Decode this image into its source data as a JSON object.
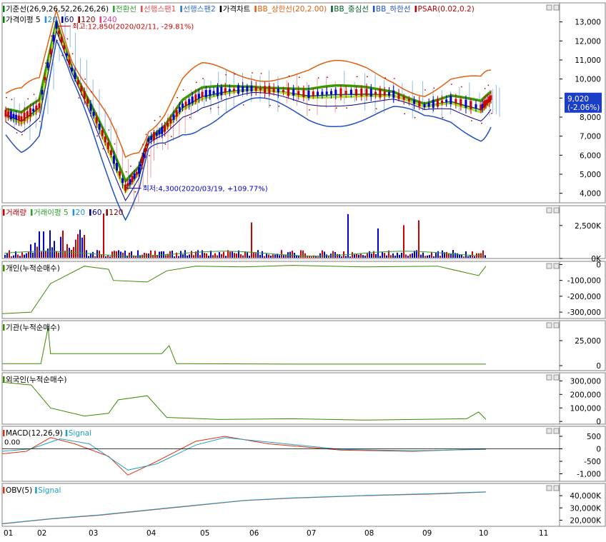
{
  "legend_main": [
    {
      "text": "기준선(26,9,26,52,26,26,26)",
      "color": "#000000",
      "mark": "#008000"
    },
    {
      "text": "전환선",
      "color": "#2ca02c",
      "mark": "#2ca02c"
    },
    {
      "text": "선행스팬1",
      "color": "#e05050",
      "mark": "#e05050"
    },
    {
      "text": "선행스팬2",
      "color": "#3070d0",
      "mark": "#3070d0"
    },
    {
      "text": "가격차트",
      "color": "#000000",
      "mark": "#000000"
    },
    {
      "text": "BB_상한선(20,2.00)",
      "color": "#e06010",
      "mark": "#e06010"
    },
    {
      "text": "BB_중심선",
      "color": "#006020",
      "mark": "#006020"
    },
    {
      "text": "BB_하한선",
      "color": "#2050c0",
      "mark": "#2050c0"
    },
    {
      "text": "PSAR(0.02,0.2)",
      "color": "#c00000",
      "mark": "#c00000"
    }
  ],
  "legend_main2": [
    {
      "text": "가격이평 5",
      "color": "#000000",
      "mark": "#008000"
    },
    {
      "text": "20",
      "color": "#2090e0",
      "mark": "#2090e0"
    },
    {
      "text": "60",
      "color": "#000080",
      "mark": "#000080"
    },
    {
      "text": "120",
      "color": "#800000",
      "mark": "#800000"
    },
    {
      "text": "240",
      "color": "#e040a0",
      "mark": "#e040a0"
    }
  ],
  "annotations": {
    "high": "최고:12,850(2020/02/11, -29.81%)",
    "low": "최저:4,300(2020/03/19, +109.77%)",
    "price_tag_value": "9,020",
    "price_tag_change": "(-2.06%)"
  },
  "legend_volume": [
    {
      "text": "거래량",
      "color": "#cc0000",
      "mark": "#cc0000"
    },
    {
      "text": "거래이평 5",
      "color": "#2ca02c",
      "mark": "#2ca02c"
    },
    {
      "text": "20",
      "color": "#2090e0",
      "mark": "#2090e0"
    },
    {
      "text": "60",
      "color": "#000080",
      "mark": "#000080"
    },
    {
      "text": "120",
      "color": "#800000",
      "mark": "#800000"
    }
  ],
  "panel_titles": {
    "individual": "개인(누적순매수)",
    "institution": "기관(누적순매수)",
    "foreign": "외국인(누적순매수)",
    "macd": "MACD(12,26,9)",
    "macd_signal": "Signal",
    "macd_zero": "0.00",
    "obv": "OBV(5)",
    "obv_signal": "Signal"
  },
  "colors": {
    "up": "#cc0000",
    "down": "#0000cc",
    "grid": "#c8c8c8",
    "line_green": "#3a8a00",
    "macd": "#e03010",
    "signal": "#20a0c0"
  },
  "chart_data": [
    {
      "type": "candlestick",
      "title": "",
      "ylim": [
        3500,
        14000
      ],
      "y_ticks": [
        4000,
        5000,
        6000,
        7000,
        8000,
        9000,
        10000,
        11000,
        12000,
        13000
      ],
      "y_tick_labels": [
        "4,000",
        "5,000",
        "6,000",
        "7,000",
        "8,000",
        "9,000",
        "10,000",
        "11,000",
        "12,000",
        "13,000"
      ],
      "x_months": [
        "01",
        "02",
        "03",
        "04",
        "05",
        "06",
        "07",
        "08",
        "09",
        "10",
        "11"
      ],
      "close_approx": [
        [
          "01",
          8200
        ],
        [
          "01-15",
          7900
        ],
        [
          "02-01",
          8600
        ],
        [
          "02-11",
          12850
        ],
        [
          "02-20",
          10500
        ],
        [
          "03-01",
          8500
        ],
        [
          "03-10",
          6500
        ],
        [
          "03-19",
          4300
        ],
        [
          "03-26",
          5200
        ],
        [
          "04-01",
          6800
        ],
        [
          "04-10",
          7400
        ],
        [
          "04-20",
          8600
        ],
        [
          "05-01",
          9200
        ],
        [
          "05-15",
          9400
        ],
        [
          "06-01",
          9500
        ],
        [
          "06-15",
          9400
        ],
        [
          "07-01",
          9200
        ],
        [
          "07-15",
          9300
        ],
        [
          "08-01",
          9300
        ],
        [
          "08-15",
          9200
        ],
        [
          "09-01",
          8600
        ],
        [
          "09-15",
          8900
        ],
        [
          "10-01",
          8500
        ],
        [
          "10-06",
          9020
        ]
      ],
      "high": {
        "date": "2020/02/11",
        "value": 12850
      },
      "low": {
        "date": "2020/03/19",
        "value": 4300
      },
      "last": 9020
    },
    {
      "type": "bar",
      "title": "거래량",
      "y_tick_labels": [
        "2,500K",
        "0K"
      ],
      "y_ticks": [
        2500,
        0
      ],
      "ylim": [
        0,
        4000
      ]
    },
    {
      "type": "line",
      "title": "개인(누적순매수)",
      "y_tick_labels": [
        "0",
        "-100,000",
        "-200,000",
        "-300,000"
      ],
      "y_ticks": [
        0,
        -100000,
        -200000,
        -300000
      ],
      "ylim": [
        -340000,
        20000
      ]
    },
    {
      "type": "line",
      "title": "기관(누적순매수)",
      "y_tick_labels": [
        "25,000",
        "0"
      ],
      "y_ticks": [
        25000,
        0
      ],
      "ylim": [
        -5000,
        45000
      ]
    },
    {
      "type": "line",
      "title": "외국인(누적순매수)",
      "y_tick_labels": [
        "300,000",
        "200,000",
        "100,000",
        "0"
      ],
      "y_ticks": [
        300000,
        200000,
        100000,
        0
      ],
      "ylim": [
        -20000,
        360000
      ]
    },
    {
      "type": "line",
      "title": "MACD(12,26,9)",
      "series": [
        {
          "name": "MACD(12,26,9)"
        },
        {
          "name": "Signal"
        }
      ],
      "y_tick_labels": [
        "500",
        "0",
        "-500",
        "-1,000"
      ],
      "y_ticks": [
        500,
        0,
        -500,
        -1000
      ],
      "ylim": [
        -1300,
        900
      ]
    },
    {
      "type": "line",
      "title": "OBV(5)",
      "series": [
        {
          "name": "OBV(5)"
        },
        {
          "name": "Signal"
        }
      ],
      "y_tick_labels": [
        "40,000K",
        "30,000K",
        "20,000K"
      ],
      "y_ticks": [
        40000,
        30000,
        20000
      ],
      "ylim": [
        15000,
        50000
      ]
    }
  ]
}
